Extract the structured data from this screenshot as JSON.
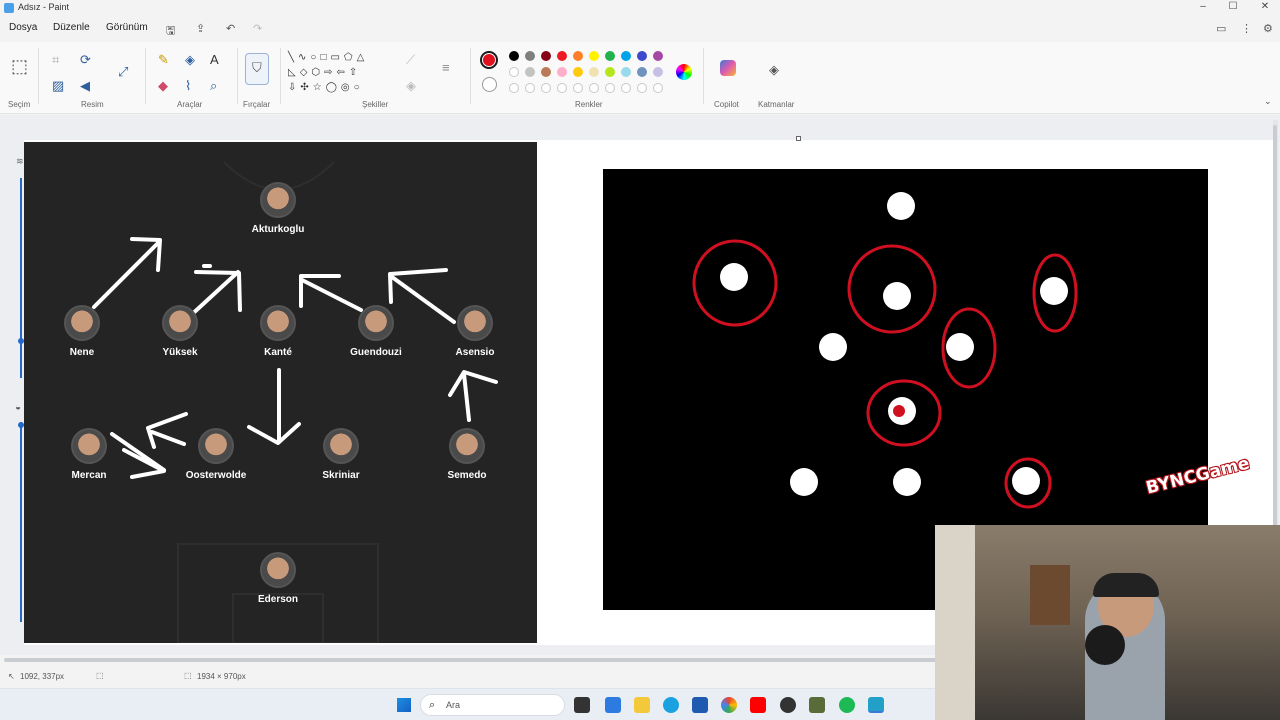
{
  "window": {
    "title": "Adsız - Paint",
    "minimize": "‒",
    "maximize": "☐",
    "close": "✕"
  },
  "menu": {
    "file": "Dosya",
    "edit": "Düzenle",
    "view": "Görünüm"
  },
  "ribbon": {
    "groups": {
      "selection": "Seçim",
      "image": "Resim",
      "tools": "Araçlar",
      "brushes": "Fırçalar",
      "shapes": "Şekiller",
      "colors": "Renkler",
      "copilot": "Copilot",
      "layers": "Katmanlar"
    },
    "palette_row1": [
      "#000000",
      "#7f7f7f",
      "#880015",
      "#ed1c24",
      "#ff7f27",
      "#fff200",
      "#22b14c",
      "#00a2e8",
      "#3f48cc",
      "#a349a4"
    ],
    "palette_row2": [
      "#ffffff",
      "#c3c3c3",
      "#b97a57",
      "#ffaec9",
      "#ffc90e",
      "#efe4b0",
      "#b5e61d",
      "#99d9ea",
      "#7092be",
      "#c8bfe7"
    ],
    "primary_color": "#e0101e",
    "secondary_color": "#ffffff"
  },
  "pitch": {
    "players": [
      {
        "name": "Akturkoglu"
      },
      {
        "name": "Nene"
      },
      {
        "name": "Yüksek"
      },
      {
        "name": "Kanté"
      },
      {
        "name": "Guendouzi"
      },
      {
        "name": "Asensio"
      },
      {
        "name": "Mercan"
      },
      {
        "name": "Oosterwolde"
      },
      {
        "name": "Skriniar"
      },
      {
        "name": "Semedo"
      },
      {
        "name": "Ederson"
      }
    ]
  },
  "status": {
    "cursor": "1092, 337px",
    "canvas_size": "1934 × 970px"
  },
  "taskbar": {
    "search": "Ara"
  },
  "watermark": "BYNCGame"
}
